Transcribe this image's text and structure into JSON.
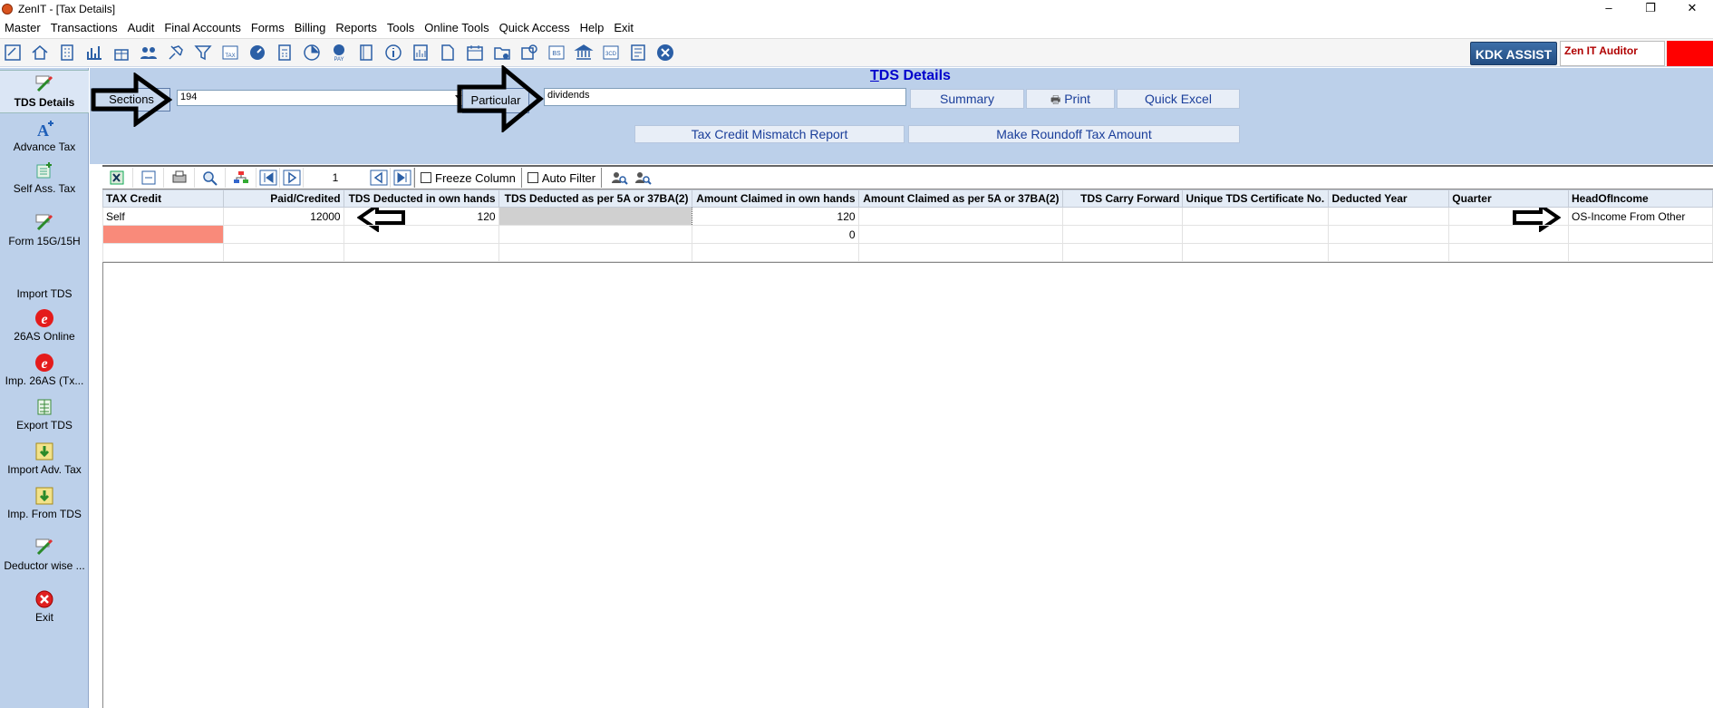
{
  "window": {
    "title": "ZenIT - [Tax Details]",
    "minimize": "–",
    "restore": "❐",
    "close": "✕"
  },
  "menu": [
    {
      "key": "master",
      "label": "Master"
    },
    {
      "key": "transactions",
      "label": "Transactions"
    },
    {
      "key": "audit",
      "label": "Audit"
    },
    {
      "key": "final-accounts",
      "label": "Final Accounts"
    },
    {
      "key": "forms",
      "label": "Forms"
    },
    {
      "key": "billing",
      "label": "Billing"
    },
    {
      "key": "reports",
      "label": "Reports"
    },
    {
      "key": "tools",
      "label": "Tools"
    },
    {
      "key": "online-tools",
      "label": "Online Tools"
    },
    {
      "key": "quick-access",
      "label": "Quick Access"
    },
    {
      "key": "help",
      "label": "Help"
    },
    {
      "key": "exit",
      "label": "Exit"
    }
  ],
  "toolbar": {
    "icons": [
      "tax-details-icon",
      "home-icon",
      "building-icon",
      "bar-chart-icon",
      "gift-icon",
      "users-icon",
      "pin-icon",
      "filter-icon",
      "tax-icon",
      "speedometer-icon",
      "calculator-icon",
      "pie-chart-icon",
      "pay-icon",
      "book-icon",
      "info-icon",
      "report-icon",
      "document-icon",
      "calendar-icon",
      "folder-add-icon",
      "refresh-icon",
      "bs-icon",
      "bank-icon",
      "3cd-icon",
      "form-icon",
      "close-circle-icon"
    ],
    "bs_label": "BS",
    "cd_label": "3CD",
    "pay_label": "PAY",
    "tax_label": "TAX",
    "kdk_assist": "KDK ASSIST",
    "user_label": "Zen IT Auditor"
  },
  "sidebar": {
    "items": [
      {
        "key": "tds-details",
        "label": "TDS Details",
        "icon": "tax-edit-icon",
        "active": true
      },
      {
        "key": "advance-tax",
        "label": "Advance Tax",
        "icon": "font-plus-icon"
      },
      {
        "key": "self-ass-tax",
        "label": "Self Ass. Tax",
        "icon": "list-plus-icon"
      },
      {
        "key": "form-15g",
        "label": "Form 15G/15H",
        "icon": "tax-edit-icon"
      },
      {
        "key": "import-tds",
        "label": "Import TDS",
        "icon": "blank-icon"
      },
      {
        "key": "26as-online",
        "label": "26AS Online",
        "icon": "e-icon"
      },
      {
        "key": "imp-26as",
        "label": "Imp. 26AS (Tx...",
        "icon": "e-icon"
      },
      {
        "key": "export-tds",
        "label": "Export TDS",
        "icon": "sheet-icon"
      },
      {
        "key": "import-adv-tax",
        "label": "Import Adv. Tax",
        "icon": "import-down-icon"
      },
      {
        "key": "imp-from-tds",
        "label": "Imp. From TDS",
        "icon": "import-down-icon"
      },
      {
        "key": "deductor-wise",
        "label": "Deductor wise ...",
        "icon": "tax-edit-icon"
      },
      {
        "key": "exit",
        "label": "Exit",
        "icon": "close-red-icon"
      }
    ],
    "tax_badge": "TAX"
  },
  "header": {
    "title_first": "T",
    "title_rest": "DS Details",
    "sections_label": "Sections",
    "sections_value": "194",
    "particular_label": "Particular",
    "particular_value": "dividends",
    "summary": "Summary",
    "print": "Print",
    "quick_excel": "Quick Excel",
    "mismatch": "Tax Credit Mismatch Report",
    "roundoff": "Make Roundoff Tax Amount"
  },
  "gridbar": {
    "page": "1",
    "freeze_column": "Freeze Column",
    "auto_filter": "Auto Filter"
  },
  "table": {
    "columns": [
      "TAX Credit",
      "Paid/Credited",
      "TDS Deducted in own hands",
      "TDS Deducted as per 5A or 37BA(2)",
      "Amount Claimed in own hands",
      "Amount Claimed as per 5A or 37BA(2)",
      "TDS Carry Forward",
      "Unique TDS Certificate No.",
      "Deducted Year",
      "Quarter",
      "HeadOfIncome"
    ],
    "rows": [
      {
        "tax_credit": "Self",
        "paid": "12000",
        "tds_own": "120",
        "tds_5a": "",
        "claimed_own": "120",
        "claimed_5a": "",
        "carry": "",
        "cert": "",
        "year": "",
        "quarter": "",
        "head": "OS-Income From Other"
      },
      {
        "tax_credit": "",
        "paid": "",
        "tds_own": "",
        "tds_5a": "",
        "claimed_own": "0",
        "claimed_5a": "",
        "carry": "",
        "cert": "",
        "year": "",
        "quarter": "",
        "head": ""
      },
      {
        "tax_credit": "",
        "paid": "",
        "tds_own": "",
        "tds_5a": "",
        "claimed_own": "",
        "claimed_5a": "",
        "carry": "",
        "cert": "",
        "year": "",
        "quarter": "",
        "head": ""
      }
    ]
  },
  "colors": {
    "panel_blue": "#bcd0ea",
    "title_blue": "#0000cc",
    "salmon": "#f98a7a",
    "kdk_blue": "#234d82",
    "red": "#ff0000"
  }
}
